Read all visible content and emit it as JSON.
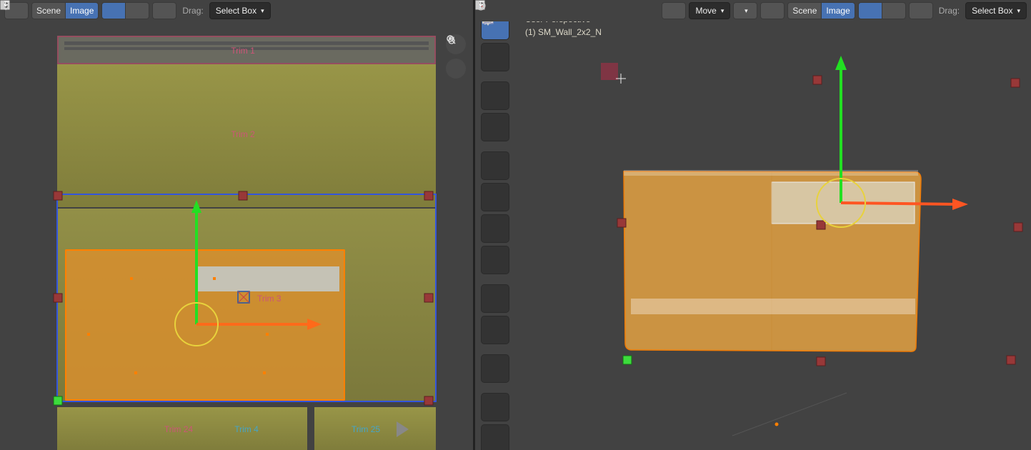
{
  "hdr": {
    "scene": "Scene",
    "image": "Image",
    "drag": "Drag:",
    "select": "Select Box",
    "move": "Move"
  },
  "info": {
    "perspective": "User Perspective",
    "obj": "(1) SM_Wall_2x2_N"
  },
  "trims": {
    "t1": "Trim 1",
    "t2": "Trim 2",
    "t3": "Trim 3",
    "t4": "Trim 4",
    "t24": "Trim 24",
    "t25": "Trim 25"
  }
}
